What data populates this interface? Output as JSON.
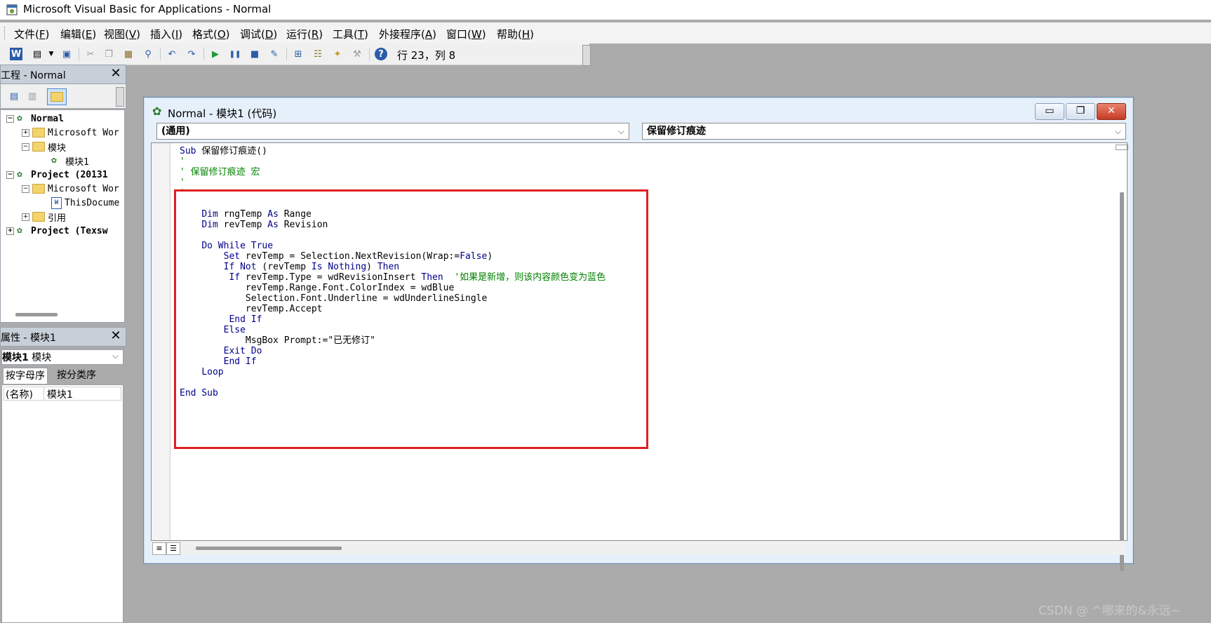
{
  "window": {
    "title": "Microsoft Visual Basic for Applications - Normal"
  },
  "menu": [
    {
      "text": "文件(",
      "key": "F",
      "tail": ")"
    },
    {
      "text": "编辑(",
      "key": "E",
      "tail": ")"
    },
    {
      "text": "视图(",
      "key": "V",
      "tail": ")"
    },
    {
      "text": "插入(",
      "key": "I",
      "tail": ")"
    },
    {
      "text": "格式(",
      "key": "O",
      "tail": ")"
    },
    {
      "text": "调试(",
      "key": "D",
      "tail": ")"
    },
    {
      "text": "运行(",
      "key": "R",
      "tail": ")"
    },
    {
      "text": "工具(",
      "key": "T",
      "tail": ")"
    },
    {
      "text": "外接程序(",
      "key": "A",
      "tail": ")"
    },
    {
      "text": "窗口(",
      "key": "W",
      "tail": ")"
    },
    {
      "text": "帮助(",
      "key": "H",
      "tail": ")"
    }
  ],
  "toolbar": {
    "cursor_position": "行 23，列 8"
  },
  "project_pane": {
    "title": "工程 - Normal",
    "tree": [
      {
        "label": "Normal",
        "bold": true
      },
      {
        "label": "Microsoft Wor"
      },
      {
        "label": "模块"
      },
      {
        "label": "模块1"
      },
      {
        "label": "Project (20131",
        "bold": true
      },
      {
        "label": "Microsoft Wor"
      },
      {
        "label": "ThisDocume"
      },
      {
        "label": "引用"
      },
      {
        "label": "Project (Texsw",
        "bold": true
      }
    ]
  },
  "properties_pane": {
    "title": "属性 - 模块1",
    "object": "模块1",
    "object_type": "模块",
    "tabs": [
      "按字母序",
      "按分类序"
    ],
    "row_name": "(名称)",
    "row_value": "模块1"
  },
  "code_window": {
    "title": "Normal - 模块1 (代码)",
    "object_combo": "(通用)",
    "procedure_combo": "保留修订痕迹"
  },
  "watermark": "CSDN @ ^哪来的&永远~"
}
